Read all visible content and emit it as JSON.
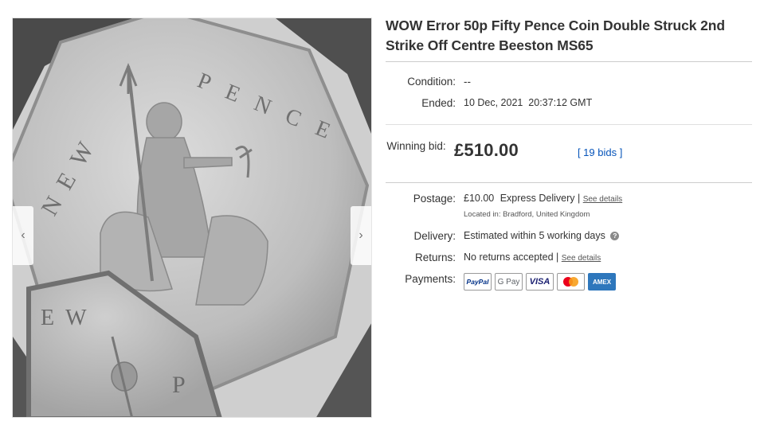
{
  "listing": {
    "title": "WOW Error 50p Fifty Pence Coin Double Struck 2nd Strike Off Centre Beeston MS65"
  },
  "coin_image": {
    "upper_legend_left": "NEW",
    "upper_legend_right": "PENCE",
    "lower_legend_left": "EW",
    "lower_legend_right": "P"
  },
  "details": {
    "condition_label": "Condition:",
    "condition_value": "--",
    "ended_label": "Ended:",
    "ended_value": "10 Dec, 2021  20:37:12 GMT",
    "winning_label": "Winning bid:",
    "winning_price": "£510.00",
    "bids_text": "19 bids",
    "postage_label": "Postage:",
    "postage_price": "£10.00",
    "postage_service": "Express Delivery",
    "see_details": "See details",
    "located_in": "Located in:  Bradford, United Kingdom",
    "delivery_label": "Delivery:",
    "delivery_value": "Estimated within 5 working days",
    "returns_label": "Returns:",
    "returns_value": "No returns accepted",
    "payments_label": "Payments:"
  },
  "payments": [
    {
      "name": "PayPal",
      "text": "PayPal",
      "color": "#003087"
    },
    {
      "name": "Google Pay",
      "text": "G Pay",
      "color": "#5f6368"
    },
    {
      "name": "Visa",
      "text": "VISA",
      "color": "#1a1f71"
    },
    {
      "name": "Mastercard",
      "text": "",
      "color": "#eb001b"
    },
    {
      "name": "American Express",
      "text": "AMEX",
      "color": "#2e77bc"
    }
  ],
  "icons": {
    "prev": "chevron-left-icon",
    "next": "chevron-right-icon",
    "help": "question-circle-icon"
  }
}
